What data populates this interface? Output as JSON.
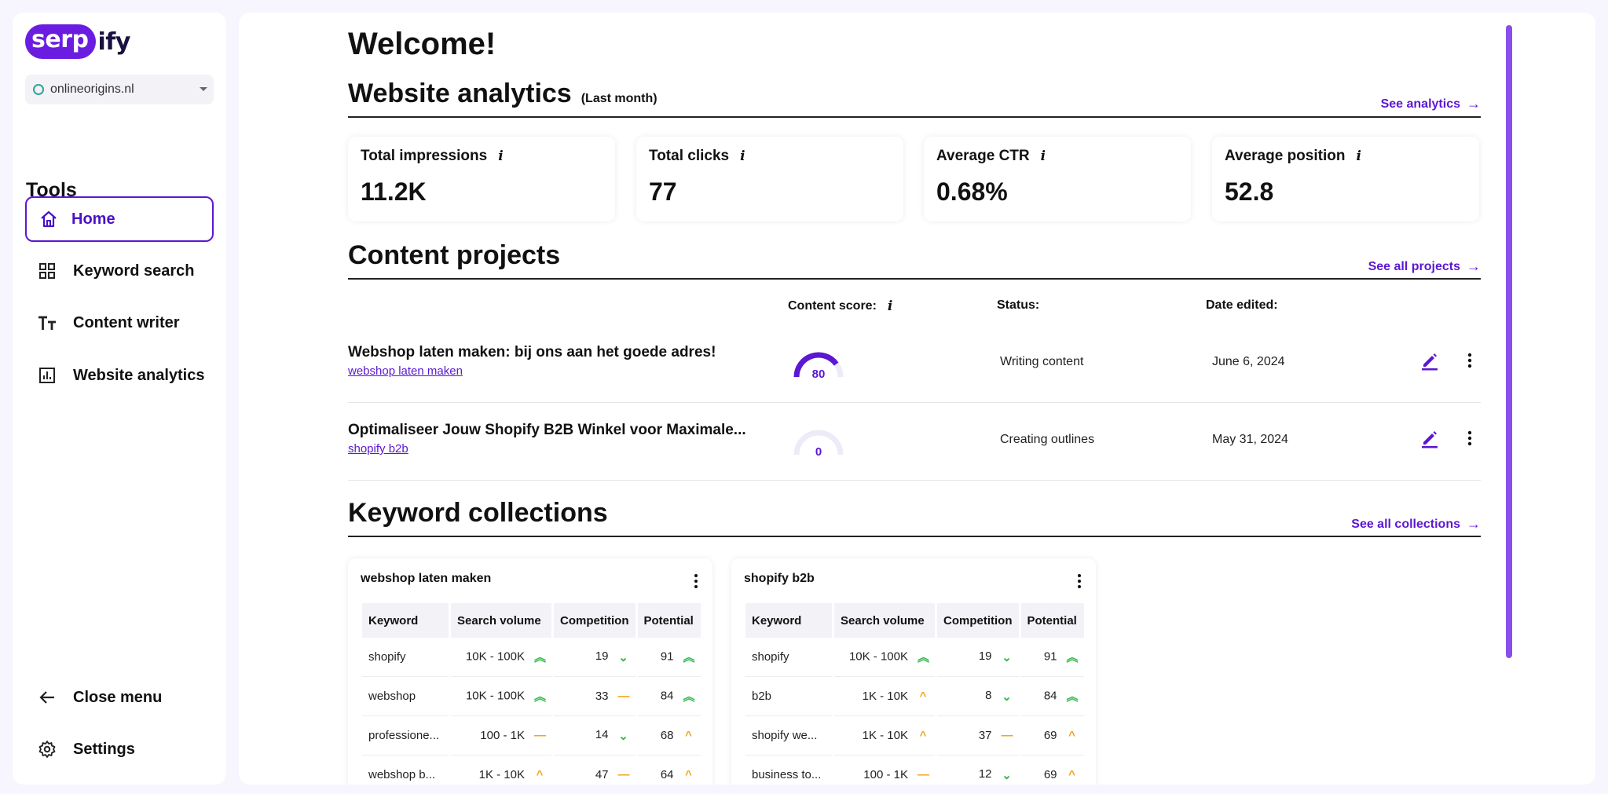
{
  "logo": {
    "pill": "serp",
    "rest": "ify"
  },
  "site_selector": {
    "value": "onlineorigins.nl"
  },
  "sidebar": {
    "tools_title": "Tools",
    "items": [
      {
        "label": "Home"
      },
      {
        "label": "Keyword search"
      },
      {
        "label": "Content writer"
      },
      {
        "label": "Website analytics"
      }
    ],
    "close_menu": "Close menu",
    "settings": "Settings"
  },
  "main": {
    "welcome": "Welcome!",
    "analytics": {
      "title": "Website analytics",
      "subtitle": "(Last month)",
      "see_link": "See analytics",
      "stats": [
        {
          "label": "Total impressions",
          "value": "11.2K"
        },
        {
          "label": "Total clicks",
          "value": "77"
        },
        {
          "label": "Average CTR",
          "value": "0.68%"
        },
        {
          "label": "Average position",
          "value": "52.8"
        }
      ]
    },
    "projects": {
      "title": "Content projects",
      "see_link": "See all projects",
      "columns": {
        "score": "Content score:",
        "status": "Status:",
        "date": "Date edited:"
      },
      "rows": [
        {
          "title": "Webshop laten maken: bij ons aan het goede adres!",
          "keyword": "webshop laten maken",
          "score": "80",
          "score_fraction": 0.8,
          "status": "Writing content",
          "date": "June 6, 2024"
        },
        {
          "title": "Optimaliseer Jouw Shopify B2B Winkel voor Maximale...",
          "keyword": "shopify b2b",
          "score": "0",
          "score_fraction": 0,
          "status": "Creating outlines",
          "date": "May 31, 2024"
        }
      ]
    },
    "collections": {
      "title": "Keyword collections",
      "see_link": "See all collections",
      "headers": [
        "Keyword",
        "Search volume",
        "Competition",
        "Potential"
      ],
      "cards": [
        {
          "title": "webshop laten maken",
          "rows": [
            [
              "shopify",
              "10K - 100K",
              "19",
              "91"
            ],
            [
              "webshop",
              "10K - 100K",
              "33",
              "84"
            ],
            [
              "professione...",
              "100 - 1K",
              "14",
              "68"
            ],
            [
              "webshop b...",
              "1K - 10K",
              "47",
              "64"
            ]
          ]
        },
        {
          "title": "shopify b2b",
          "rows": [
            [
              "shopify",
              "10K - 100K",
              "19",
              "91"
            ],
            [
              "b2b",
              "1K - 10K",
              "8",
              "84"
            ],
            [
              "shopify we...",
              "1K - 10K",
              "37",
              "69"
            ],
            [
              "business to...",
              "100 - 1K",
              "12",
              "69"
            ]
          ]
        }
      ]
    }
  },
  "colors": {
    "accent": "#5b17d2",
    "brand": "#6a1de0",
    "trend_good": "#2fb84b",
    "trend_mid": "#f2a51b"
  }
}
